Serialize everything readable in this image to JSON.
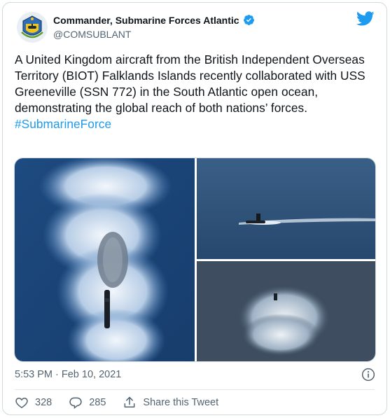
{
  "account": {
    "display_name": "Commander, Submarine Forces Atlantic",
    "handle": "@COMSUBLANT",
    "verified": true
  },
  "tweet": {
    "text": "A United Kingdom aircraft from the British Independent Overseas Territory (BIOT) Falklands Islands recently collaborated with USS Greeneville (SSN 772) in the South Atlantic open ocean, demonstrating the global reach of both nations’ forces.",
    "hashtag": "#SubmarineForce",
    "timestamp": "5:53 PM · Feb 10, 2021"
  },
  "media": [
    {
      "icon": "submarine-wake-photo"
    },
    {
      "icon": "submarine-surfaced-photo"
    },
    {
      "icon": "submarine-spray-photo"
    }
  ],
  "actions": {
    "like_count": "328",
    "reply_count": "285",
    "share_label": "Share this Tweet"
  },
  "colors": {
    "accent": "#1d9bf0",
    "text": "#0f1419",
    "secondary": "#536471",
    "border": "#cfd9de"
  }
}
